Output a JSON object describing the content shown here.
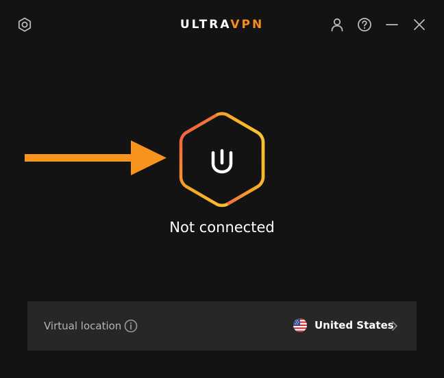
{
  "header": {
    "brand_part1": "ULTRA",
    "brand_part2": "VPN",
    "icons": [
      "settings-icon",
      "user-icon",
      "help-icon",
      "minimize-icon",
      "close-icon"
    ]
  },
  "connection": {
    "status": "Not connected",
    "button_icon": "power-icon"
  },
  "location": {
    "label": "Virtual location",
    "country": "United States",
    "flag": "us-flag-icon"
  },
  "colors": {
    "background": "#131313",
    "panel": "#272727",
    "accent_orange": "#f68b1f",
    "gradient_red": "#ef4b4b",
    "gradient_yellow": "#fbc02d",
    "arrow": "#f7941d"
  }
}
